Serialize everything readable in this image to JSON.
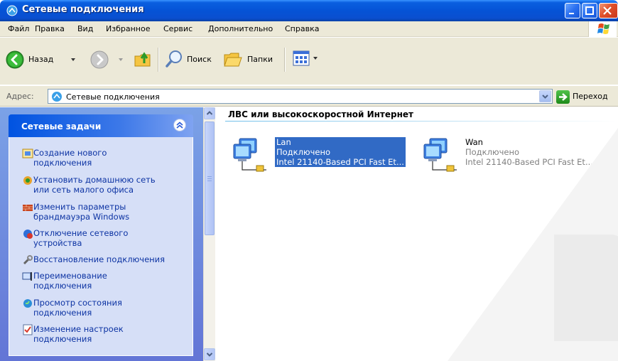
{
  "window": {
    "title": "Сетевые подключения",
    "buttons": [
      "minimize",
      "maximize",
      "close"
    ]
  },
  "menu": {
    "items": [
      "Файл",
      "Правка",
      "Вид",
      "Избранное",
      "Сервис",
      "Дополнительно",
      "Справка"
    ]
  },
  "toolbar": {
    "back_label": "Назад",
    "search_label": "Поиск",
    "folders_label": "Папки"
  },
  "address": {
    "label": "Адрес:",
    "value": "Сетевые подключения",
    "go_label": "Переход"
  },
  "task_pane": {
    "title": "Сетевые задачи",
    "items": [
      {
        "line1": "Создание нового",
        "line2": "подключения",
        "icon": "new-connection-icon"
      },
      {
        "line1": "Установить домашнюю сеть",
        "line2": "или сеть малого офиса",
        "icon": "home-network-icon"
      },
      {
        "line1": "Изменить параметры",
        "line2": "брандмауэра Windows",
        "icon": "firewall-icon"
      },
      {
        "line1": "Отключение сетевого",
        "line2": "устройства",
        "icon": "disable-device-icon"
      },
      {
        "line1": "Восстановление подключения",
        "line2": "",
        "icon": "repair-icon"
      },
      {
        "line1": "Переименование",
        "line2": "подключения",
        "icon": "rename-icon"
      },
      {
        "line1": "Просмотр состояния",
        "line2": "подключения",
        "icon": "status-icon"
      },
      {
        "line1": "Изменение настроек",
        "line2": "подключения",
        "icon": "settings-icon"
      }
    ]
  },
  "content": {
    "group_header": "ЛВС или высокоскоростной Интернет",
    "connections": [
      {
        "name": "Lan",
        "status": "Подключено",
        "device": "Intel 21140-Based PCI Fast Et...",
        "selected": true
      },
      {
        "name": "Wan",
        "status": "Подключено",
        "device": "Intel 21140-Based PCI Fast Et...",
        "selected": false
      }
    ]
  },
  "colors": {
    "titlebar": "#0553d6",
    "link": "#0c33a3",
    "selection": "#316ac5"
  }
}
